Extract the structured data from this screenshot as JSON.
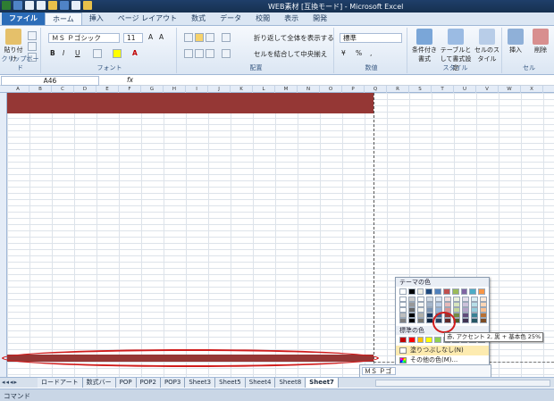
{
  "titlebar": {
    "title": "WEB素材 [互換モード] - Microsoft Excel"
  },
  "ribbon": {
    "tabs": [
      {
        "label": "ファイル"
      },
      {
        "label": "ホーム"
      },
      {
        "label": "挿入"
      },
      {
        "label": "ページ レイアウト"
      },
      {
        "label": "数式"
      },
      {
        "label": "データ"
      },
      {
        "label": "校閲"
      },
      {
        "label": "表示"
      },
      {
        "label": "開発"
      }
    ],
    "clipboard": {
      "paste_label": "貼り付け",
      "group_label": "クリップボード"
    },
    "font": {
      "name": "ＭＳ Ｐゴシック",
      "size": "11",
      "group_label": "フォント"
    },
    "alignment": {
      "wrap_text": "折り返して全体を表示する",
      "merge_center": "セルを結合して中央揃え",
      "group_label": "配置"
    },
    "number": {
      "format": "標準",
      "group_label": "数値"
    },
    "styles": {
      "conditional": "条件付き書式",
      "table": "テーブルとして書式設定",
      "cell": "セルのスタイル",
      "group_label": "スタイル"
    },
    "cells": {
      "insert": "挿入",
      "delete": "削除",
      "group_label": "セル"
    }
  },
  "formula_bar": {
    "name_box": "A46",
    "fx": "fx",
    "content": ""
  },
  "grid": {
    "columns": [
      "A",
      "B",
      "C",
      "D",
      "E",
      "F",
      "G",
      "H",
      "I",
      "J",
      "K",
      "L",
      "M",
      "N",
      "O",
      "P",
      "Q",
      "R",
      "S",
      "T",
      "U",
      "V",
      "W",
      "X"
    ],
    "row_count": 45
  },
  "palette": {
    "theme_label": "テーマの色",
    "standard_label": "標準の色",
    "no_fill": "塗りつぶしなし(N)",
    "more_colors": "その他の色(M)...",
    "tooltip": "赤, アクセント 2, 黒 + 基本色 25%",
    "theme_colors": [
      "#ffffff",
      "#000000",
      "#eeece1",
      "#1f497d",
      "#4f81bd",
      "#c0504d",
      "#9bbb59",
      "#8064a2",
      "#4bacc6",
      "#f79646"
    ],
    "standard_colors": [
      "#c00000",
      "#ff0000",
      "#ffc000",
      "#ffff00",
      "#92d050",
      "#00b050",
      "#00b0f0",
      "#0070c0",
      "#002060",
      "#7030a0"
    ],
    "selected_color": "#953735"
  },
  "mini_toolbar": {
    "font": "ＭＳ Ｐゴ",
    "bold": "B",
    "italic": "I"
  },
  "sheet_tabs": [
    {
      "label": "ロードアート"
    },
    {
      "label": "数式バー"
    },
    {
      "label": "POP"
    },
    {
      "label": "POP2"
    },
    {
      "label": "POP3"
    },
    {
      "label": "Sheet3"
    },
    {
      "label": "Sheet5"
    },
    {
      "label": "Sheet4"
    },
    {
      "label": "Sheet8"
    },
    {
      "label": "Sheet7"
    }
  ],
  "statusbar": {
    "mode": "コマンド"
  },
  "colors": {
    "band": "#953735",
    "mark": "#d01c1c",
    "accent": "#2b6cb8"
  }
}
